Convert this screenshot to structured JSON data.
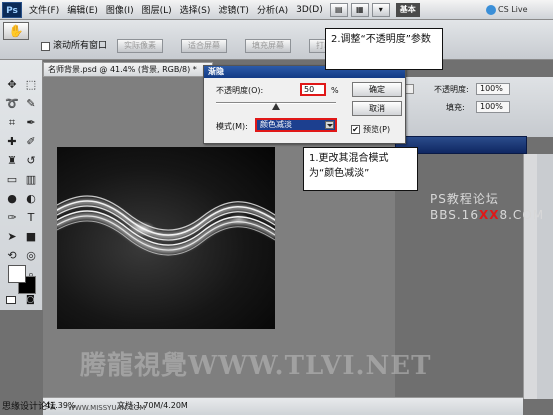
{
  "menubar": {
    "logo": "Ps",
    "items": [
      "文件(F)",
      "编辑(E)",
      "图像(I)",
      "图层(L)",
      "选择(S)",
      "滤镜(T)",
      "分析(A)",
      "3D(D)"
    ],
    "workspace": "基本",
    "cs_live": "CS Live"
  },
  "options": {
    "scroll_all": "滚动所有窗口",
    "buttons": [
      "实际像素",
      "适合屏幕",
      "填充屏幕",
      "打印尺寸"
    ]
  },
  "document": {
    "tab_title": "名师背景.psd @ 41.4% (背景, RGB/8) *",
    "zoom": "41.39%",
    "doc_size": "文档:1.70M/4.20M"
  },
  "panel": {
    "opacity_label": "不透明度:",
    "opacity_value": "100%",
    "fill_label": "填充:",
    "fill_value": "100%"
  },
  "dialog": {
    "title": "渐隐",
    "opacity_label": "不透明度(O):",
    "opacity_value": "50",
    "percent": "%",
    "mode_label": "模式(M):",
    "mode_value": "颜色减淡",
    "ok_label": "确定",
    "cancel_label": "取消",
    "preview_label": "预览(P)",
    "preview_checked": "✔"
  },
  "callouts": {
    "step2": "2.调整“不透明度”参数",
    "step1": "1.更改其混合模式为“颜色减淡”"
  },
  "watermarks": {
    "ps_site": "PS教程论坛",
    "bbs_prefix": "BBS.16",
    "bbs_red": "XX",
    "bbs_suffix": "8.COM",
    "bottom_brand": "腾龍視覺WWW.TLVI.NET",
    "bottom_left": "思缘设计论坛",
    "bottom_left_small": "WWW.MISSYUAN.COM"
  },
  "colors": {
    "accent_red": "#e01818",
    "dialog_title": "#1f4a98",
    "select_blue": "#1c3f8f"
  }
}
